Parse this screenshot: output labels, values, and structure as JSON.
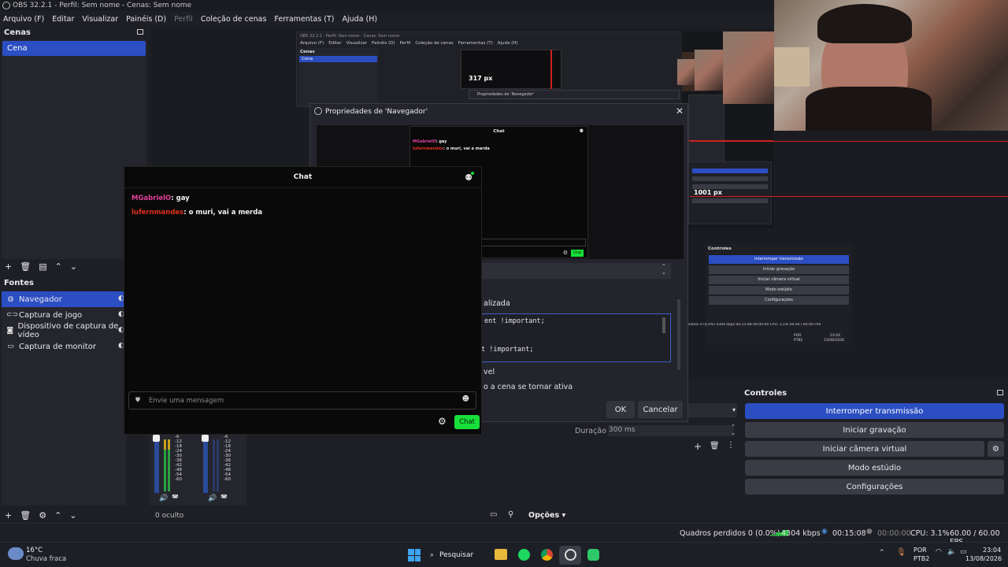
{
  "window": {
    "title": "OBS 32.2.1 - Perfil: Sem nome - Cenas: Sem nome"
  },
  "menu": [
    "Arquivo (F)",
    "Editar",
    "Visualizar",
    "Painéis (D)",
    "Perfil",
    "Coleção de cenas",
    "Ferramentas (T)",
    "Ajuda (H)"
  ],
  "scenes": {
    "title": "Cenas",
    "items": [
      "Cena"
    ]
  },
  "sources": {
    "title": "Fontes",
    "items": [
      "Navegador",
      "Captura de jogo",
      "Dispositivo de captura de vídeo",
      "Captura de monitor"
    ]
  },
  "mixer": {
    "ticks": [
      "-6",
      "-12",
      "-18",
      "-24",
      "-30",
      "-36",
      "-42",
      "-48",
      "-54",
      "-60"
    ],
    "hidden_count": "0 oculto",
    "options_label": "Opções"
  },
  "transitions": {
    "duration_label": "Duração",
    "duration_value": "300 ms"
  },
  "controls": {
    "title": "Controles",
    "buttons": [
      "Interromper transmissão",
      "Iniciar gravação",
      "Iniciar câmera virtual",
      "Modo estúdio",
      "Configurações"
    ]
  },
  "dialog": {
    "title": "Propriedades de 'Navegador'",
    "partial_label_1": "alizada",
    "css_line_1": "ent !important;",
    "css_line_2": "t !important;",
    "partial_label_2": "vel",
    "partial_label_3": "o a cena se tornar ativa",
    "ok": "OK",
    "cancel": "Cancelar"
  },
  "chat": {
    "title": "Chat",
    "messages": [
      {
        "user": "MGabrielO",
        "text": ": gay",
        "color": "#e0409a"
      },
      {
        "user": "lufernmandes",
        "text": ": o muri, vai a merda",
        "color": "#e0301e"
      }
    ],
    "input_placeholder": "Envie uma mensagem",
    "send_label": "Chat",
    "send_color": "#18e03a"
  },
  "nested": {
    "px_label_1": "317 px",
    "px_label_2": "1001 px",
    "mini_title": "OBS 32.2.1 - Perfil: Sem nome - Cenas: Sem nome",
    "mini_menu": [
      "Arquivo (F)",
      "Editar",
      "Visualizar",
      "Painéis (D)",
      "Perfil",
      "Coleção de cenas",
      "Ferramentas (T)",
      "Ajuda (H)"
    ],
    "mini_scenes_title": "Cenas",
    "mini_scene": "Cena",
    "mini_dialog_title": "Propriedades de 'Navegador'",
    "mini_chat_title": "Chat",
    "mini_msg_1_user": "MGabrielO",
    "mini_msg_1_text": ": gay",
    "mini_msg_2_user": "lufernmandes",
    "mini_msg_2_text": ": o muri, vai a merda",
    "mini_send": "Chat",
    "mini_controls_title": "Controles",
    "mini_controls": [
      "Interromper transmissão",
      "Iniciar gravação",
      "Iniciar câmera virtual",
      "Modo estúdio",
      "Configurações"
    ],
    "mini_status": "ondros 0 (0,0%)   4304 kbps   00:15:08   00:00:00   CPU: 3.1%   60.00 / 60.00 FPS",
    "mini_tray_lang": "POR",
    "mini_tray_layout": "PTB2",
    "mini_tray_time": "23:04",
    "mini_tray_date": "13/08/2026"
  },
  "status": {
    "dropped": "Quadros perdidos 0 (0.0%)",
    "bitrate": "4304 kbps",
    "stream_time": "00:15:08",
    "rec_time": "00:00:00",
    "cpu": "CPU: 3.1%",
    "fps": "60.00 / 60.00 FPS"
  },
  "taskbar": {
    "weather_temp": "16°C",
    "weather_desc": "Chuva fraca",
    "search": "Pesquisar",
    "lang": "POR",
    "layout": "PTB2",
    "time": "23:04",
    "date": "13/08/2026"
  },
  "colors": {
    "accent": "#2b4ec2",
    "bg": "#1e1f25",
    "chat_bg": "#090909",
    "live_green": "#18e03a"
  }
}
